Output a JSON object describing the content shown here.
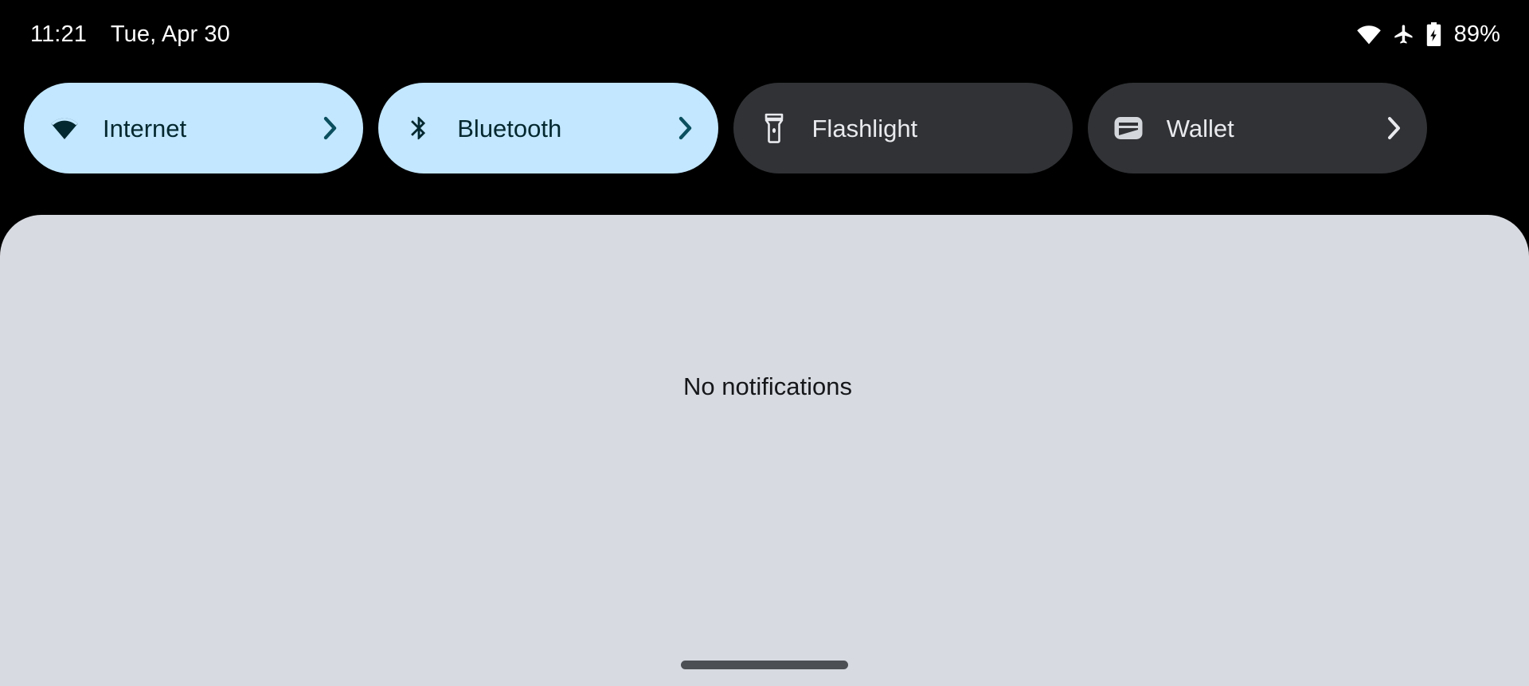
{
  "status_bar": {
    "clock": "11:21",
    "date": "Tue, Apr 30",
    "battery_percent": "89%",
    "icons": [
      "wifi-icon",
      "airplane-mode-icon",
      "battery-charging-icon"
    ]
  },
  "quick_settings": {
    "tiles": [
      {
        "label": "Internet",
        "icon": "wifi-icon",
        "state": "active",
        "has_chevron": true
      },
      {
        "label": "Bluetooth",
        "icon": "bluetooth-icon",
        "state": "active",
        "has_chevron": true
      },
      {
        "label": "Flashlight",
        "icon": "flashlight-icon",
        "state": "inactive",
        "has_chevron": false
      },
      {
        "label": "Wallet",
        "icon": "wallet-icon",
        "state": "inactive",
        "has_chevron": true
      }
    ]
  },
  "notification_shade": {
    "empty_text": "No notifications"
  },
  "colors": {
    "background": "#000000",
    "tile_active_bg": "#c2e7ff",
    "tile_active_fg": "#04282f",
    "tile_inactive_bg": "#303235",
    "tile_inactive_fg": "#e8eaed",
    "panel_bg": "#d7dae0",
    "panel_fg": "#15171a",
    "home_indicator": "#4c5055"
  }
}
